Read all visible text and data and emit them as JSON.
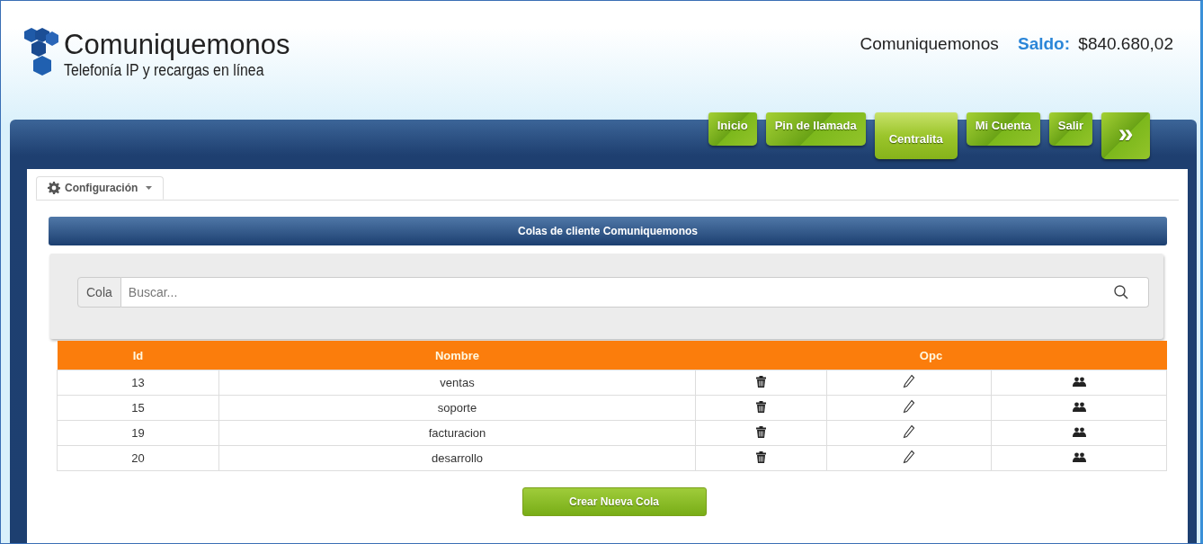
{
  "logo": {
    "name": "Comuniquemonos",
    "tagline": "Telefonía IP y recargas en línea"
  },
  "account": {
    "user": "Comuniquemonos",
    "balance_label": "Saldo:",
    "balance": "$840.680,02"
  },
  "nav": [
    {
      "label": "Inicio",
      "selected": false,
      "kind": "text"
    },
    {
      "label": "Pin de llamada",
      "selected": false,
      "kind": "text"
    },
    {
      "label": "Centralita",
      "selected": true,
      "kind": "text"
    },
    {
      "label": "Mi Cuenta",
      "selected": false,
      "kind": "text"
    },
    {
      "label": "Salir",
      "selected": false,
      "kind": "text"
    },
    {
      "label": "»",
      "selected": false,
      "kind": "more"
    }
  ],
  "config_tab": {
    "label": "Configuración"
  },
  "panel_title": "Colas de cliente Comuniquemonos",
  "search": {
    "addon": "Cola",
    "placeholder": "Buscar..."
  },
  "table": {
    "columns": [
      "Id",
      "Nombre",
      "Opc"
    ],
    "rows": [
      {
        "id": "13",
        "nombre": "ventas"
      },
      {
        "id": "15",
        "nombre": "soporte"
      },
      {
        "id": "19",
        "nombre": "facturacion"
      },
      {
        "id": "20",
        "nombre": "desarrollo"
      }
    ]
  },
  "create_button": "Crear Nueva Cola"
}
